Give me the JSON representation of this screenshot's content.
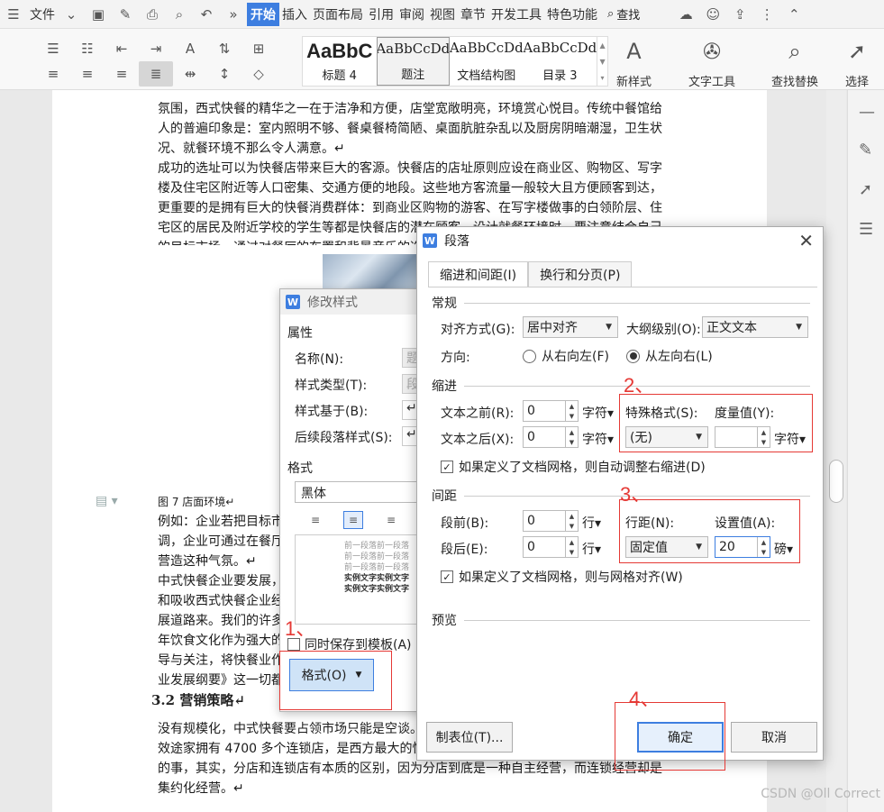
{
  "menu": {
    "file": "文件",
    "tabs": [
      "开始",
      "插入",
      "页面布局",
      "引用",
      "审阅",
      "视图",
      "章节",
      "开发工具",
      "特色功能"
    ],
    "search": "查找"
  },
  "ribbon": {
    "styles": [
      {
        "preview": "AaBbC",
        "name": "标题 4"
      },
      {
        "preview": "AaBbCcDd",
        "name": "题注"
      },
      {
        "preview": "AaBbCcDd",
        "name": "文档结构图"
      },
      {
        "preview": "AaBbCcDd",
        "name": "目录 3"
      }
    ],
    "new_style": "新样式",
    "text_tools": "文字工具",
    "find_replace": "查找替换",
    "select": "选择"
  },
  "document": {
    "p1": "氛围，西式快餐的精华之一在于洁净和方便，店堂宽敞明亮，环境赏心悦目。传统中餐馆给人的普遍印象是：室内照明不够、餐桌餐椅简陋、桌面肮脏杂乱以及厨房阴暗潮湿，卫生状况、就餐环境不那么令人满意。↵",
    "p2": "成功的选址可以为快餐店带来巨大的客源。快餐店的店址原则应设在商业区、购物区、写字楼及住宅区附近等人口密集、交通方便的地段。这些地方客流量一般较大且方便顾客到达，更重要的是拥有巨大的快餐消费群体：到商业区购物的游客、在写字楼做事的白领阶层、住宅区的居民及附近学校的学生等都是快餐店的潜在顾客。设计就餐环境时，要注意结合自己的目标市场，通过对餐厅的布置和背景音乐的选",
    "caption": "图 7 店面环境↵",
    "p3": "例如：企业若把目标市调，企业可通过在餐厅营造这种气氛。↵",
    "p4": "中式快餐企业要发展，和吸收西式快餐企业经展道路来。我们的许多年饮食文化作为强大的导与关注，将快餐业作业发展纲要》这一切都",
    "heading": "3.2 营销策略↵",
    "p5": "没有规模化，中式快餐要占领市场只能是空谈。统一生产、连锁经营才是发挥规模效益的有效途家拥有 4700 多个连锁店，是西方最大的快餐连锁店之一。中国老字号开分店是常有的事，其实，分店和连锁店有本质的区别，因为分店到底是一种自主经营，而连锁经营却是集约化经营。↵"
  },
  "modify_style": {
    "title": "修改样式",
    "section_props": "属性",
    "name_label": "名称(N):",
    "name_value": "题",
    "type_label": "样式类型(T):",
    "type_value": "段",
    "based_label": "样式基于(B):",
    "based_value": "↵",
    "follow_label": "后续段落样式(S):",
    "follow_value": "↵",
    "section_format": "格式",
    "font": "黑体",
    "preview_prev": [
      "前一段落前一段落",
      "前一段落前一段落",
      "前一段落前一段落"
    ],
    "preview_sample": [
      "实例文字实例文字",
      "实例文字实例文字"
    ],
    "save_template": "同时保存到模板(A)",
    "format_button": "格式(O)"
  },
  "paragraph": {
    "title": "段落",
    "tab_indent": "缩进和间距(I)",
    "tab_breaks": "换行和分页(P)",
    "sec_general": "常规",
    "align_label": "对齐方式(G):",
    "align_value": "居中对齐",
    "outline_label": "大纲级别(O):",
    "outline_value": "正文文本",
    "direction_label": "方向:",
    "rtl": "从右向左(F)",
    "ltr": "从左向右(L)",
    "sec_indent": "缩进",
    "before_text_label": "文本之前(R):",
    "before_text_value": "0",
    "after_text_label": "文本之后(X):",
    "after_text_value": "0",
    "unit_char": "字符",
    "special_label": "特殊格式(S):",
    "special_value": "(无)",
    "measure_label": "度量值(Y):",
    "measure_value": "",
    "auto_indent": "如果定义了文档网格，则自动调整右缩进(D)",
    "sec_spacing": "间距",
    "before_label": "段前(B):",
    "before_value": "0",
    "after_label": "段后(E):",
    "after_value": "0",
    "unit_line": "行",
    "line_spacing_label": "行距(N):",
    "line_spacing_value": "固定值",
    "set_value_label": "设置值(A):",
    "set_value": "20",
    "unit_pound": "磅",
    "snap_grid": "如果定义了文档网格，则与网格对齐(W)",
    "sec_preview": "预览",
    "tabs_button": "制表位(T)...",
    "ok": "确定",
    "cancel": "取消"
  },
  "annotations": {
    "n1": "1、",
    "n2": "2、",
    "n3": "3、",
    "n4": "4、",
    "color": "#e53935"
  },
  "watermark": "CSDN @Oll Correct"
}
